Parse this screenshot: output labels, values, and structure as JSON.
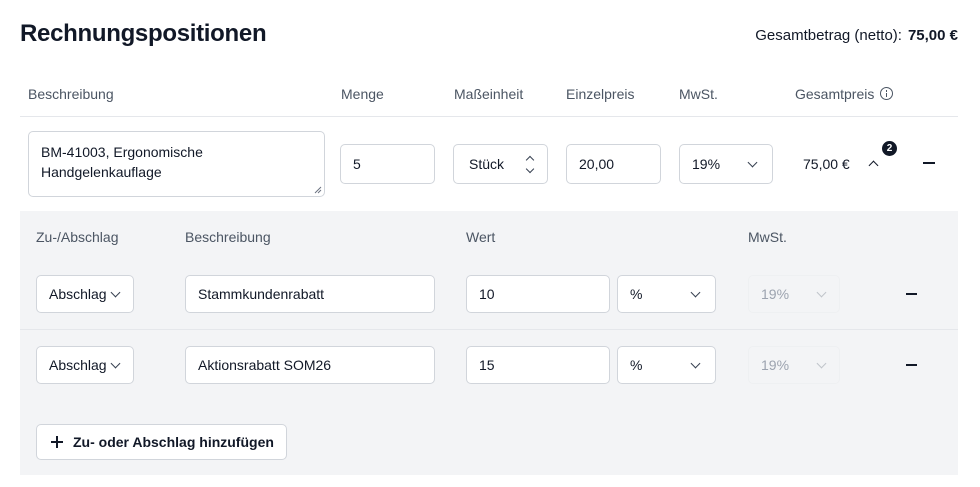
{
  "header": {
    "title": "Rechnungspositionen",
    "total_label": "Gesamtbetrag (netto):",
    "total_value": "75,00 €"
  },
  "columns": {
    "description": "Beschreibung",
    "quantity": "Menge",
    "unit": "Maßeinheit",
    "unit_price": "Einzelpreis",
    "vat": "MwSt.",
    "total": "Gesamtpreis"
  },
  "position": {
    "description": "BM-41003, Ergonomische Handgelenkauflage",
    "quantity": "5",
    "unit": "Stück",
    "unit_price": "20,00",
    "vat": "19%",
    "total": "75,00 €",
    "adjustment_count": "2"
  },
  "adjustments": {
    "columns": {
      "type": "Zu-/Abschlag",
      "description": "Beschreibung",
      "value": "Wert",
      "vat": "MwSt."
    },
    "rows": [
      {
        "type": "Abschlag",
        "description": "Stammkundenrabatt",
        "value": "10",
        "value_type": "%",
        "vat": "19%"
      },
      {
        "type": "Abschlag",
        "description": "Aktionsrabatt SOM26",
        "value": "15",
        "value_type": "%",
        "vat": "19%"
      }
    ],
    "add_label": "Zu- oder Abschlag hinzufügen"
  },
  "icons": {
    "info": "info-icon",
    "collapse": "chevron-up-icon",
    "remove": "minus-icon",
    "add": "plus-icon",
    "dropdown": "chevron-down-icon",
    "stepper": "chevron-up-down-icon"
  }
}
